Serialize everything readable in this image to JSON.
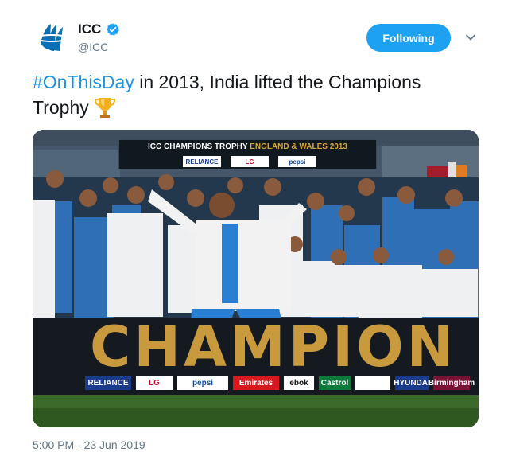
{
  "author": {
    "display_name": "ICC",
    "handle": "@ICC",
    "verified": true,
    "avatar_icon": "icc-logo-icon"
  },
  "follow_button": {
    "label": "Following"
  },
  "caret_icon": "chevron-down-icon",
  "tweet": {
    "hashtag": "#OnThisDay",
    "text": " in 2013, India lifted the Champions Trophy",
    "emoji_icon": "trophy-icon"
  },
  "media": {
    "top_banner": {
      "title_prefix": "ICC CHAMPIONS TROPHY ",
      "title_gold": "ENGLAND & WALES 2013",
      "sponsors": [
        "RELIANCE",
        "LG",
        "pepsi"
      ]
    },
    "board_word": "CHAMPION",
    "ads": [
      "RELIANCE",
      "LG",
      "pepsi",
      "Emirates",
      "ebok",
      "Castrol",
      "",
      "HYUNDAI",
      "Birmingham"
    ]
  },
  "timestamp": "5:00 PM - 23 Jun 2019",
  "colors": {
    "accent": "#1da1f2",
    "hashtag": "#1b95e0",
    "secondary_text": "#657786",
    "verified": "#1da1f2"
  }
}
